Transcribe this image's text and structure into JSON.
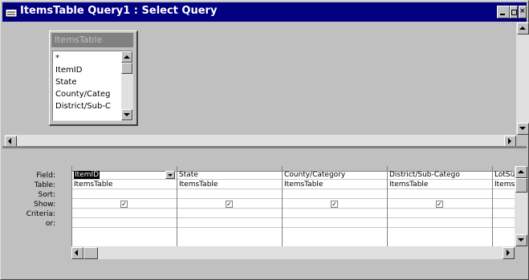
{
  "window": {
    "title": "ItemsTable Query1 : Select Query",
    "controls": [
      "minimize-icon",
      "restore-icon",
      "close-icon"
    ]
  },
  "field_list": {
    "title": "ItemsTable",
    "items": [
      "*",
      "ItemID",
      "State",
      "County/Categ",
      "District/Sub-C"
    ]
  },
  "grid": {
    "row_labels": [
      "Field:",
      "Table:",
      "Sort:",
      "Show:",
      "Criteria:",
      "or:"
    ],
    "columns": [
      {
        "field": "ItemID",
        "table": "ItemsTable",
        "sort": "",
        "show": true,
        "criteria": "",
        "or": "",
        "selected": true
      },
      {
        "field": "State",
        "table": "ItemsTable",
        "sort": "",
        "show": true,
        "criteria": "",
        "or": ""
      },
      {
        "field": "County/Category",
        "table": "ItemsTable",
        "sort": "",
        "show": true,
        "criteria": "",
        "or": ""
      },
      {
        "field": "District/Sub-Catego",
        "table": "ItemsTable",
        "sort": "",
        "show": true,
        "criteria": "",
        "or": ""
      },
      {
        "field": "LotSize",
        "table": "ItemsT",
        "sort": "",
        "show": false,
        "criteria": "",
        "or": ""
      }
    ]
  },
  "colors": {
    "titlebar": "#000080",
    "face": "#c0c0c0",
    "fieldlist_title": "#808080"
  }
}
